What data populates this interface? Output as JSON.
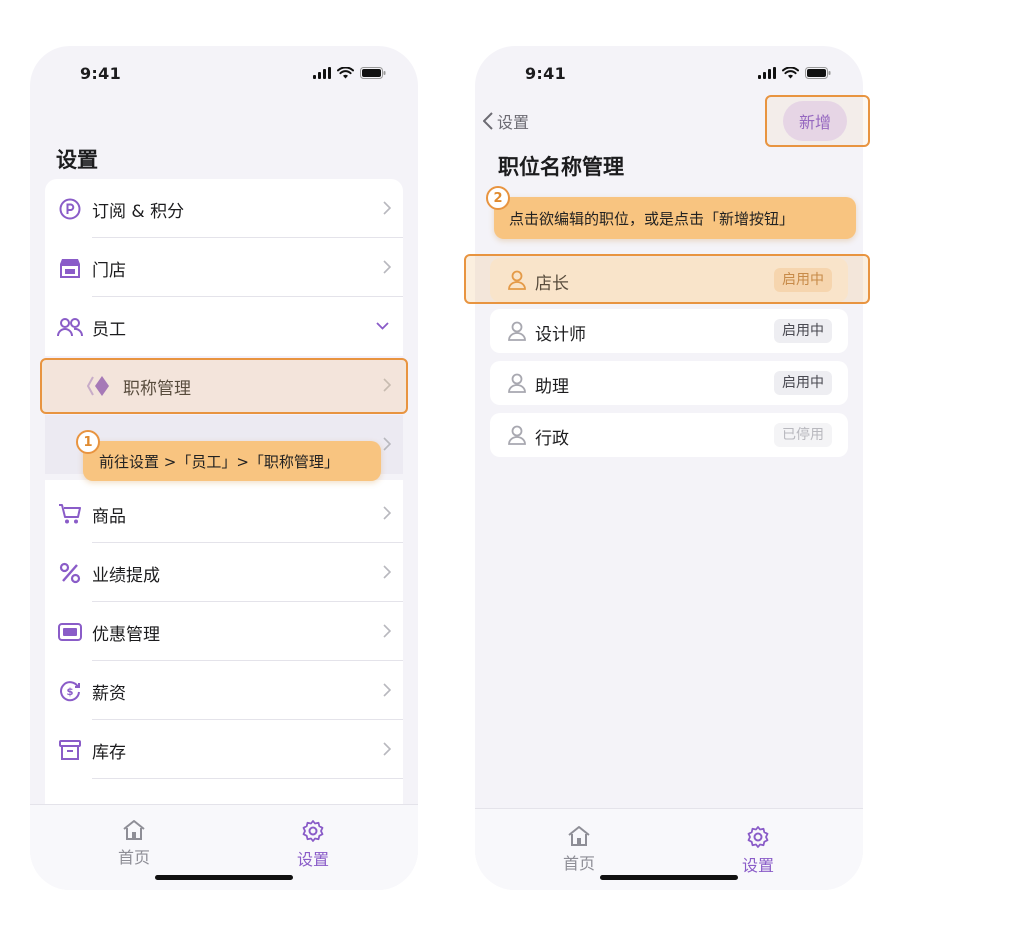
{
  "status_bar": {
    "time": "9:41"
  },
  "left_screen": {
    "title": "设置",
    "menu": [
      {
        "label": "订阅 & 积分",
        "icon": "points-circle-icon"
      },
      {
        "label": "门店",
        "icon": "store-icon"
      },
      {
        "label": "员工",
        "icon": "staff-people-icon",
        "expanded": true
      },
      {
        "label": "职称管理",
        "icon": "title-diamond-icon",
        "sub": true
      },
      {
        "label": "商品",
        "icon": "cart-icon"
      },
      {
        "label": "业绩提成",
        "icon": "percent-icon"
      },
      {
        "label": "优惠管理",
        "icon": "coupon-icon"
      },
      {
        "label": "薪资",
        "icon": "salary-icon"
      },
      {
        "label": "库存",
        "icon": "inventory-box-icon"
      }
    ],
    "step1": {
      "number": "1",
      "text": "前往设置 >「员工」>「职称管理」"
    }
  },
  "right_screen": {
    "back_label": "设置",
    "add_button": "新增",
    "title": "职位名称管理",
    "step2": {
      "number": "2",
      "text": "点击欲编辑的职位，或是点击「新增按钮」"
    },
    "positions": [
      {
        "name": "店长",
        "status": "启用中",
        "selected": true
      },
      {
        "name": "设计师",
        "status": "启用中"
      },
      {
        "name": "助理",
        "status": "启用中"
      },
      {
        "name": "行政",
        "status": "已停用"
      }
    ]
  },
  "tab_bar": {
    "home": "首页",
    "settings": "设置"
  },
  "colors": {
    "accent": "#8a5cc8",
    "highlight_border": "#e89440",
    "tip_bg": "#f8c480"
  }
}
